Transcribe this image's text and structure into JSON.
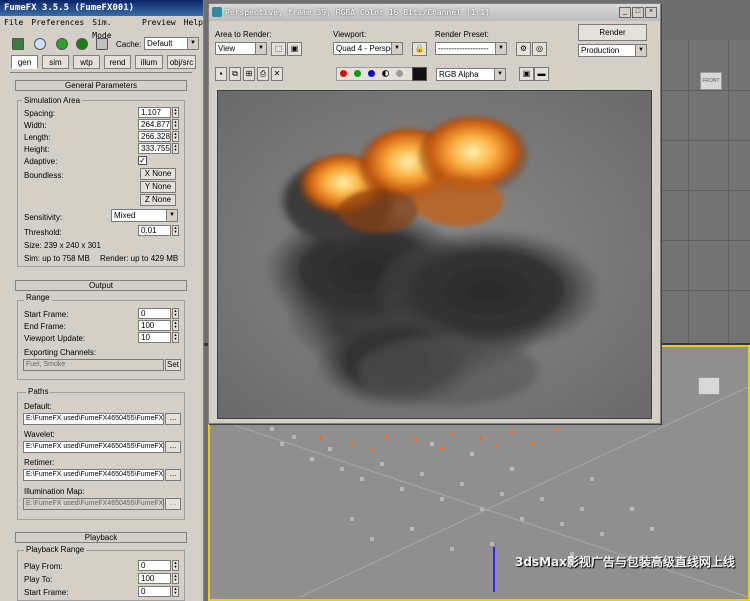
{
  "fumefx": {
    "title": "FumeFX 3.5.5 (FumeFX001)",
    "menu": [
      "File",
      "Preferences",
      "Sim. Mode",
      "Preview",
      "Help"
    ],
    "cache_label": "Cache:",
    "cache_value": "Default",
    "tabs": [
      "gen",
      "sim",
      "wtp",
      "rend",
      "illum",
      "obj/src"
    ],
    "general": {
      "header": "General Parameters",
      "group": "Simulation Area",
      "spacing_label": "Spacing:",
      "spacing": "1.107",
      "width_label": "Width:",
      "width": "264.877",
      "length_label": "Length:",
      "length": "266.328",
      "height_label": "Height:",
      "height": "333.755",
      "adaptive_label": "Adaptive:",
      "adaptive_check": "✓",
      "boundless_label": "Boundless:",
      "x_none": "X None",
      "y_none": "Y None",
      "z_none": "Z None",
      "sensitivity_label": "Sensitivity:",
      "sensitivity": "Mixed",
      "threshold_label": "Threshold:",
      "threshold": "0.01",
      "size": "Size: 239 x 240 x 301",
      "sim_mem": "Sim: up to 758 MB",
      "render_mem": "Render: up to 429 MB"
    },
    "output": {
      "header": "Output",
      "group": "Range",
      "start_label": "Start Frame:",
      "start": "0",
      "end_label": "End Frame:",
      "end": "100",
      "update_label": "Viewport Update:",
      "update": "10",
      "channels_label": "Exporting Channels:",
      "channels": "Fuel, Smoke",
      "set_label": "Set",
      "paths_group": "Paths",
      "default_label": "Default:",
      "default_path": "E:\\FumeFX used\\FumeFX4650455\\FumeFX",
      "wavelet_label": "Wavelet:",
      "wavelet_path": "E:\\FumeFX used\\FumeFX4650455\\FumeFX",
      "retimer_label": "Retimer:",
      "retimer_path": "E:\\FumeFX used\\FumeFX4650455\\FumeFX",
      "illum_label": "Illumination Map:",
      "illum_path": "E:\\FumeFX used\\FumeFX4650455\\FumeFX",
      "browse": "..."
    },
    "playback": {
      "header": "Playback",
      "group": "Playback Range",
      "from_label": "Play From:",
      "from": "0",
      "to_label": "Play To:",
      "to": "100",
      "start_label": "Start Frame:",
      "start": "0"
    }
  },
  "render_window": {
    "title": "Perspective, frame 39, RGBA Color 16 Bits/Channel (1:1)",
    "area_label": "Area to Render:",
    "area_value": "View",
    "viewport_label": "Viewport:",
    "viewport_value": "Quad 4 - Perspect",
    "preset_label": "Render Preset:",
    "preset_value": "-------------------",
    "render_button": "Render",
    "production_value": "Production",
    "channel_value": "RGB Alpha",
    "colors": {
      "red": "#e00000",
      "green": "#00a000",
      "blue": "#0000d0"
    }
  },
  "viewport": {
    "cube_label": "FRONT",
    "watermark": "3dsMax影视广告与包装高级直线网上线"
  }
}
